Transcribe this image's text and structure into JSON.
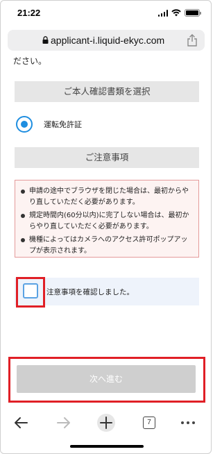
{
  "status_bar": {
    "time": "21:22"
  },
  "browser": {
    "url": "applicant-i.liquid-ekyc.com"
  },
  "page": {
    "intro_tail": "ださい。",
    "select_doc_header": "ご本人確認書類を選択",
    "document_option": "運転免許証",
    "notes_header": "ご注意事項",
    "notes": [
      "申請の途中でブラウザを閉じた場合は、最初からやり直していただく必要があります。",
      "規定時間内(60分以内)に完了しない場合は、最初からやり直していただく必要があります。",
      "機種によってはカメラへのアクセス許可ポップアップが表示されます。"
    ],
    "confirm_label": "注意事項を確認しました。",
    "next_button": "次へ進む"
  },
  "toolbar": {
    "tab_count": "7"
  },
  "colors": {
    "accent_blue": "#1e8ee0",
    "highlight_red": "#e01f26",
    "notice_border": "#e49a9a"
  }
}
